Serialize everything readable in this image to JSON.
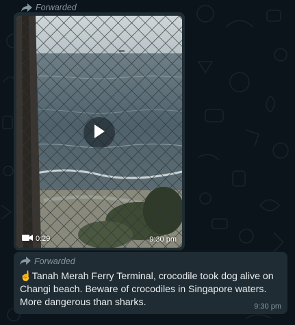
{
  "top_message": {
    "forwarded_label": "Forwarded"
  },
  "video_message": {
    "duration": "0:29",
    "time": "9:30 pm",
    "icons": [
      "video-camera-icon",
      "play-icon"
    ]
  },
  "text_message": {
    "forwarded_label": "Forwarded",
    "emoji": "☝",
    "text": "Tanah Merah Ferry Terminal, crocodile took dog alive on Changi beach. Beware of crocodiles in Singapore waters. More dangerous than sharks.",
    "time": "9:30 pm"
  },
  "colors": {
    "background": "#0b141a",
    "bubble": "#1f2c33",
    "meta_text": "#8696a0",
    "message_text": "#e9edef"
  }
}
